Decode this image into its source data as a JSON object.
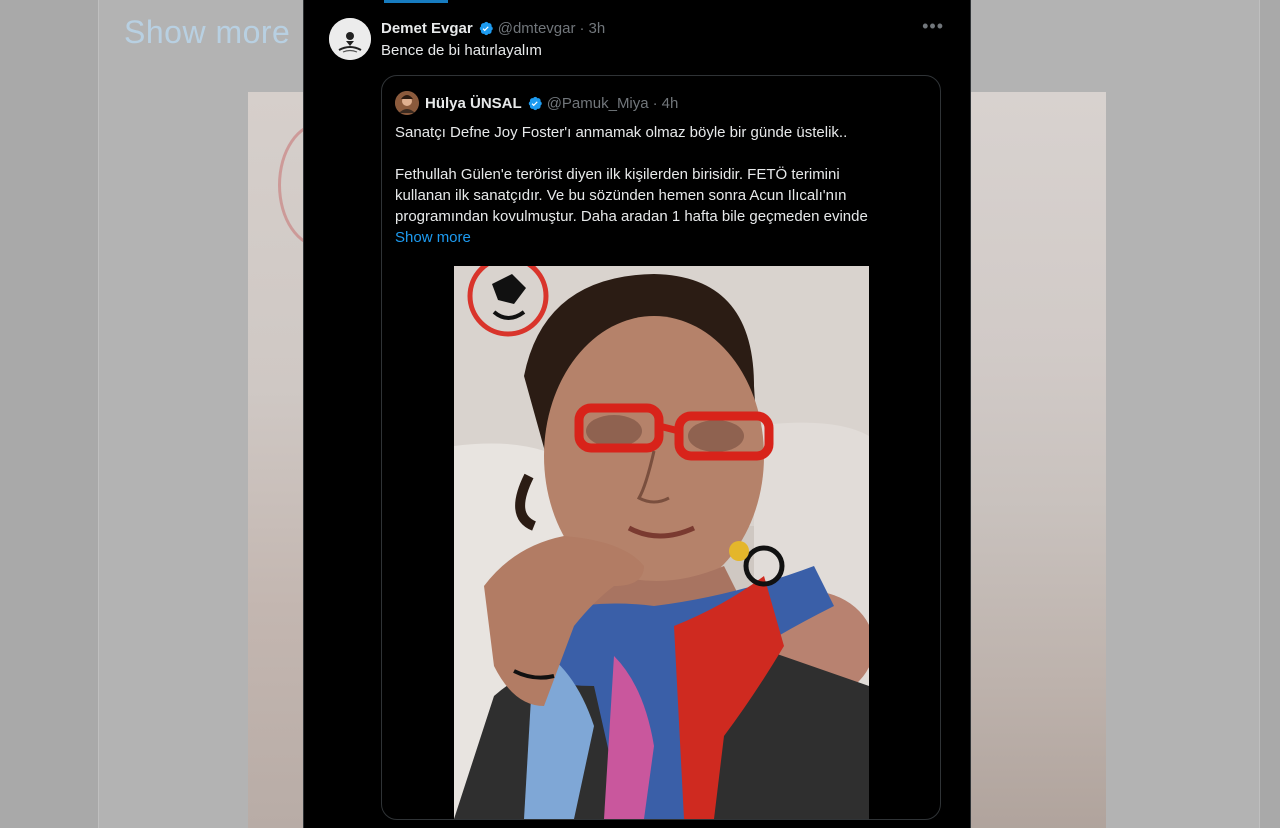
{
  "background": {
    "show_more_label": "Show more"
  },
  "tweet": {
    "author_name": "Demet Evgar",
    "author_handle": "@dmtevgar",
    "separator": "·",
    "time": "3h",
    "more_icon": "•••",
    "text": "Bence de bi hatırlayalım",
    "verified_icon": "verified-badge-icon",
    "quote": {
      "author_name": "Hülya ÜNSAL",
      "author_handle": "@Pamuk_Miya",
      "separator": "·",
      "time": "4h",
      "line1": "Sanatçı  Defne Joy Foster'ı anmamak olmaz böyle bir günde üstelik..",
      "line2": "Fethullah Gülen'e terörist diyen ilk kişilerden birisidir. FETÖ terimini",
      "line3": "kullanan ilk sanatçıdır. Ve bu sözünden hemen sonra Acun Ilıcalı'nın",
      "line4": "programından kovulmuştur. Daha aradan 1 hafta bile geçmeden evinde",
      "show_more_label": "Show more"
    }
  },
  "colors": {
    "accent": "#1d9bf0",
    "background": "#000000",
    "text": "#e7e9ea",
    "muted": "#71767b",
    "border": "#2f3336"
  }
}
